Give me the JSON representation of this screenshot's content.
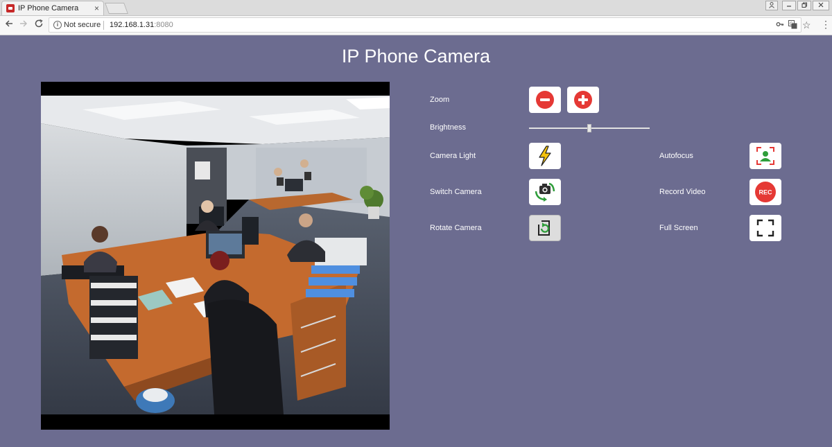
{
  "browser": {
    "tab_title": "IP Phone Camera",
    "tab_close": "×",
    "not_secure": "Not secure",
    "url_host": "192.168.1.31",
    "url_port": ":8080"
  },
  "page": {
    "title": "IP Phone Camera"
  },
  "controls": {
    "zoom_label": "Zoom",
    "brightness_label": "Brightness",
    "brightness_value": 0.5,
    "camera_light_label": "Camera Light",
    "autofocus_label": "Autofocus",
    "switch_camera_label": "Switch Camera",
    "record_video_label": "Record Video",
    "record_badge": "REC",
    "rotate_camera_label": "Rotate Camera",
    "full_screen_label": "Full Screen"
  },
  "colors": {
    "page_background": "#6c6c90",
    "accent_red": "#e53935",
    "accent_green": "#2e9e3a",
    "flash_yellow": "#f4c20d"
  }
}
